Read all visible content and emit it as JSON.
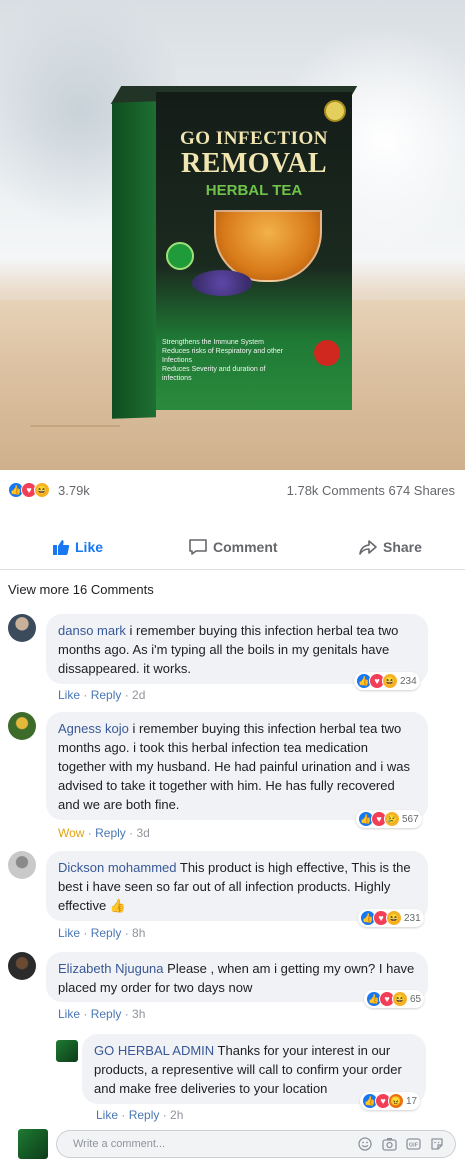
{
  "product": {
    "line1": "GO INFECTION",
    "line2": "REMOVAL",
    "line3": "HERBAL TEA",
    "features": [
      "Strengthens the Immune System",
      "Reduces risks of Respiratory and other Infections",
      "Reduces Severity and duration of infections"
    ]
  },
  "stats": {
    "reactions": "3.79k",
    "comments_shares": "1.78k Comments 674 Shares"
  },
  "actions": {
    "like": "Like",
    "comment": "Comment",
    "share": "Share"
  },
  "view_more": "View more 16 Comments",
  "comments": [
    {
      "name": "danso mark",
      "text": "i remember buying this infection herbal tea two months ago. As i'm typing all the boils in my genitals have dissappeared. it works.",
      "action1": "Like",
      "reply": "Reply",
      "time": "2d",
      "count": "234"
    },
    {
      "name": "Agness kojo",
      "text": "i remember buying this infection herbal tea two months ago. i took this herbal infection tea medication together with my husband. He had painful urination and i was advised to take it together with him. He has fully recovered and we are both fine.",
      "action1": "Wow",
      "reply": "Reply",
      "time": "3d",
      "count": "567"
    },
    {
      "name": "Dickson mohammed",
      "text": "This product is high effective, This is the best i have seen so far out of all infection products. Highly effective",
      "action1": "Like",
      "reply": "Reply",
      "time": "8h",
      "count": "231"
    },
    {
      "name": "Elizabeth Njuguna",
      "text": "Please , when am i getting my own? I have placed my order for two days now",
      "action1": "Like",
      "reply": "Reply",
      "time": "3h",
      "count": "65"
    },
    {
      "name": "GO HERBAL ADMIN",
      "text": "Thanks for your interest in our products, a representive will call to confirm your order and make free deliveries to your location",
      "action1": "Like",
      "reply": "Reply",
      "time": "2h",
      "count": "17"
    }
  ],
  "composer": {
    "placeholder": "Write a comment..."
  },
  "colors": {
    "accent": "#1877f2",
    "name": "#385898",
    "bubble": "#f0f2f5"
  }
}
